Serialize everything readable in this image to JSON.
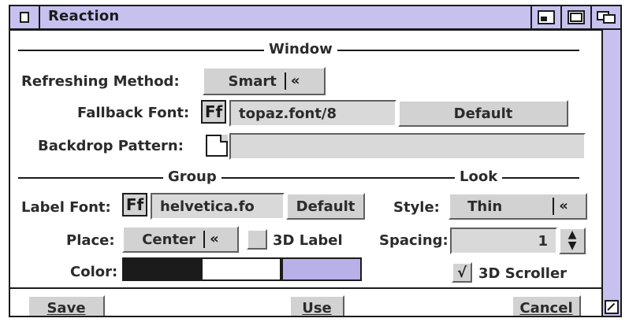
{
  "window": {
    "title": "Reaction",
    "colors": {
      "title_bar": "#c7c1f0",
      "window_bg": "#b7b7b7",
      "panel_bg": "#ffffff",
      "accent_lavender": "#b8b0e8"
    },
    "titlebar_icons": [
      "close-box-icon",
      "zoom-icon",
      "iconify-icon",
      "depth-icon"
    ]
  },
  "sections": {
    "window": {
      "title": "Window"
    },
    "group": {
      "title": "Group"
    },
    "look": {
      "title": "Look"
    }
  },
  "window_section": {
    "refreshing_method": {
      "label": "Refreshing Method:",
      "value": "Smart",
      "cycle_icon": "«"
    },
    "fallback_font": {
      "label": "Fallback Font:",
      "ff_icon": "Ff",
      "value": "topaz.font/8",
      "default_label": "Default"
    },
    "backdrop_pattern": {
      "label": "Backdrop Pattern:",
      "value": ""
    }
  },
  "group_section": {
    "label_font": {
      "label": "Label Font:",
      "ff_icon": "Ff",
      "value": "helvetica.fo",
      "default_label": "Default"
    },
    "place": {
      "label": "Place:",
      "value": "Center",
      "cycle_icon": "«",
      "label_3d": "3D Label",
      "label_3d_checked": false
    },
    "color": {
      "label": "Color:",
      "swatches": [
        "#1b1b1b",
        "#ffffff",
        "#b8b0e8"
      ]
    }
  },
  "look_section": {
    "style": {
      "label": "Style:",
      "value": "Thin",
      "cycle_icon": "«"
    },
    "spacing": {
      "label": "Spacing:",
      "value": "1"
    },
    "scroller_3d": {
      "label": "3D Scroller",
      "checked": true,
      "check_glyph": "√"
    }
  },
  "buttons": {
    "save": "Save",
    "use": "Use",
    "cancel": "Cancel"
  }
}
